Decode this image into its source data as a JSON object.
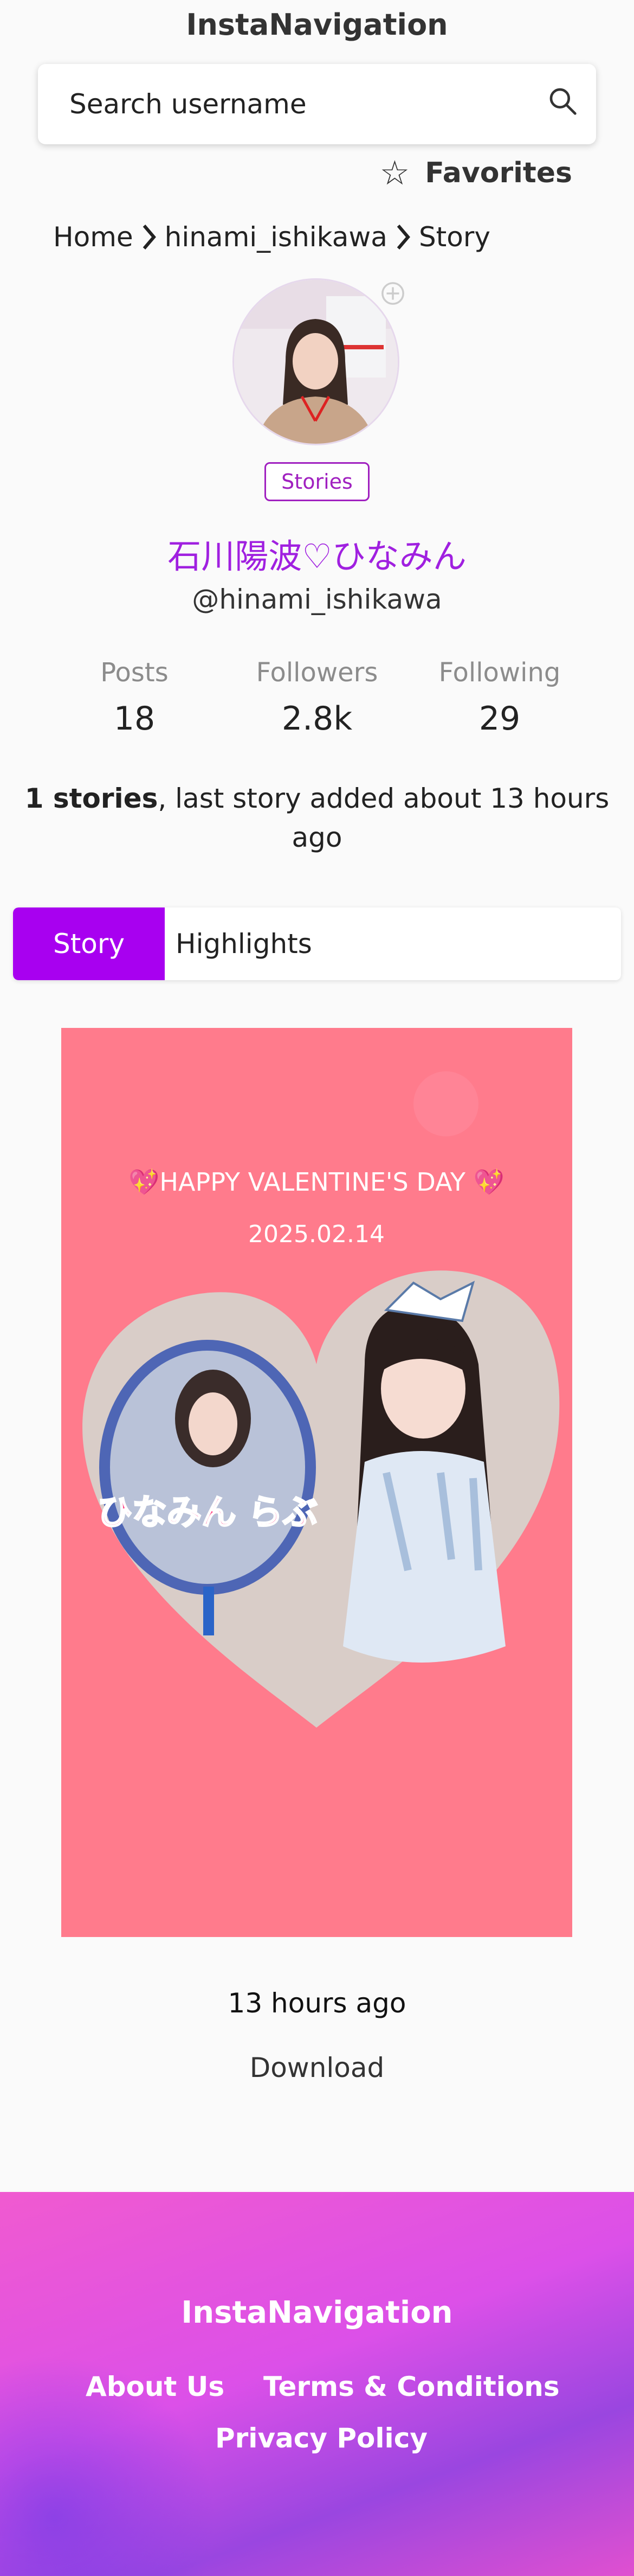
{
  "header": {
    "title": "InstaNavigation"
  },
  "search": {
    "placeholder": "Search username",
    "icon": "search-icon"
  },
  "favorites": {
    "icon": "star-outline-icon",
    "label": "Favorites"
  },
  "breadcrumb": {
    "items": [
      "Home",
      "hinami_ishikawa",
      "Story"
    ],
    "separator_icon": "chevron-right-icon"
  },
  "profile": {
    "avatar_icon": "avatar",
    "add_icon": "plus-circle-icon",
    "stories_badge": "Stories",
    "name": "石川陽波♡ひなみん",
    "handle": "@hinami_ishikawa",
    "stats": [
      {
        "label": "Posts",
        "value": "18"
      },
      {
        "label": "Followers",
        "value": "2.8k"
      },
      {
        "label": "Following",
        "value": "29"
      }
    ],
    "stories_count": "1 stories",
    "stories_suffix": ", last story added about 13 hours ago"
  },
  "tabs": [
    {
      "label": "Story",
      "active": true
    },
    {
      "label": "Highlights",
      "active": false
    }
  ],
  "story": {
    "headline": "💖HAPPY VALENTINE'S DAY 💖",
    "date": "2025.02.14",
    "fan_text": "ひなみん らぶ",
    "background_color": "#ff7b8c",
    "time_ago": "13 hours ago",
    "download_label": "Download"
  },
  "footer": {
    "title": "InstaNavigation",
    "links": [
      "About Us",
      "Terms & Conditions",
      "Privacy Policy"
    ]
  },
  "colors": {
    "accent": "#a800f0",
    "name": "#a020e0",
    "footer_gradient_start": "#f05ad0",
    "footer_gradient_end": "#9a46e0"
  }
}
